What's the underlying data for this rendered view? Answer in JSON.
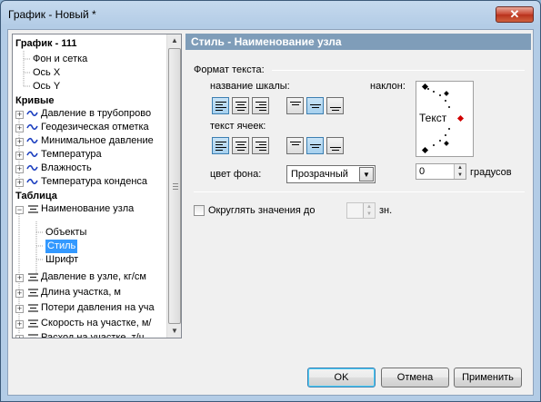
{
  "window": {
    "title": "График - Новый *",
    "close_label": "✕"
  },
  "tree": {
    "root": "График - 111",
    "root_children": [
      "Фон и сетка",
      "Ось X",
      "Ось Y"
    ],
    "curves_label": "Кривые",
    "curves": [
      "Давление в трубопрово",
      "Геодезическая отметка",
      "Минимальное давление",
      "Температура",
      "Влажность",
      "Температура конденса"
    ],
    "table_label": "Таблица",
    "table_node": "Наименование узла",
    "table_node_children": [
      "Объекты",
      "Стиль",
      "Шрифт"
    ],
    "table_items": [
      "Давление в узле, кг/см",
      "Длина участка, м",
      "Потери давления на уча",
      "Скорость на участке, м/",
      "Расход на участке, т/ч"
    ],
    "selected": "Стиль"
  },
  "panel": {
    "header": "Стиль - Наименование узла",
    "text_format_label": "Формат текста:",
    "scale_name_label": "название шкалы:",
    "cell_text_label": "текст ячеек:",
    "tilt_label": "наклон:",
    "preview_text": "Текст",
    "bg_color_label": "цвет фона:",
    "bg_color_value": "Прозрачный",
    "angle_value": "0",
    "degrees_label": "градусов",
    "round_label": "Округлять значения до",
    "round_value": "",
    "round_unit": "зн."
  },
  "buttons": {
    "ok": "OK",
    "cancel": "Отмена",
    "apply": "Применить"
  },
  "colors": {
    "header_bg": "#7f9db9",
    "selection": "#3399ff",
    "frame": "#b3cce6"
  }
}
